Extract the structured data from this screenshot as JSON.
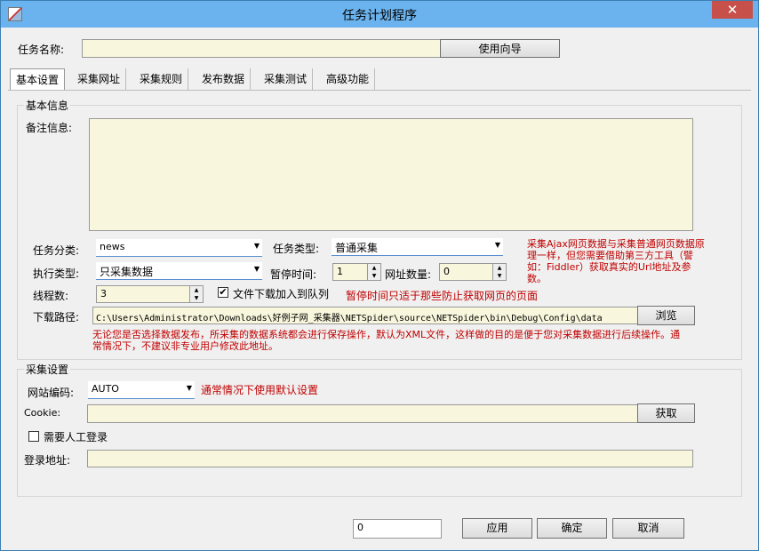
{
  "window": {
    "title": "任务计划程序",
    "close": "✕"
  },
  "task_name": {
    "label": "任务名称:",
    "value": "",
    "wizard_button": "使用向导"
  },
  "tabs": [
    "基本设置",
    "采集网址",
    "采集规则",
    "发布数据",
    "采集测试",
    "高级功能"
  ],
  "basic_info": {
    "group_title": "基本信息",
    "notes_label": "备注信息:",
    "notes_value": "",
    "task_category_label": "任务分类:",
    "task_category_value": "news",
    "task_type_label": "任务类型:",
    "task_type_value": "普通采集",
    "exec_type_label": "执行类型:",
    "exec_type_value": "只采集数据",
    "pause_label": "暂停时间:",
    "pause_value": "1",
    "url_count_label": "网址数量:",
    "url_count_value": "0",
    "threads_label": "线程数:",
    "threads_value": "3",
    "download_queue_label": "文件下载加入到队列",
    "download_queue_checked": true,
    "download_path_label": "下载路径:",
    "download_path_value": "C:\\Users\\Administrator\\Downloads\\好例子网_采集器\\NETSpider\\source\\NETSpider\\bin\\Debug\\Config\\data",
    "browse_button": "浏览",
    "ajax_note": "采集Ajax网页数据与采集普通网页数据原理一样，但您需要借助第三方工具（譬如：Fiddler）获取真实的Url地址及参数。",
    "pause_note": "暂停时间只适于那些防止获取网页的页面",
    "publish_note": "无论您是否选择数据发布，所采集的数据系统都会进行保存操作，默认为XML文件，这样做的目的是便于您对采集数据进行后续操作。通常情况下，不建议非专业用户修改此地址。"
  },
  "collect_settings": {
    "group_title": "采集设置",
    "encoding_label": "网站编码:",
    "encoding_value": "AUTO",
    "encoding_note": "通常情况下使用默认设置",
    "cookie_label": "Cookie:",
    "cookie_value": "",
    "get_button": "获取",
    "manual_login_label": "需要人工登录",
    "manual_login_checked": false,
    "login_url_label": "登录地址:",
    "login_url_value": ""
  },
  "footer": {
    "value": "0",
    "apply": "应用",
    "ok": "确定",
    "cancel": "取消"
  },
  "colors": {
    "titlebar": "#6bb3ee",
    "close": "#c7504b",
    "input_bg": "#f8f6dc",
    "note": "#c00000"
  }
}
